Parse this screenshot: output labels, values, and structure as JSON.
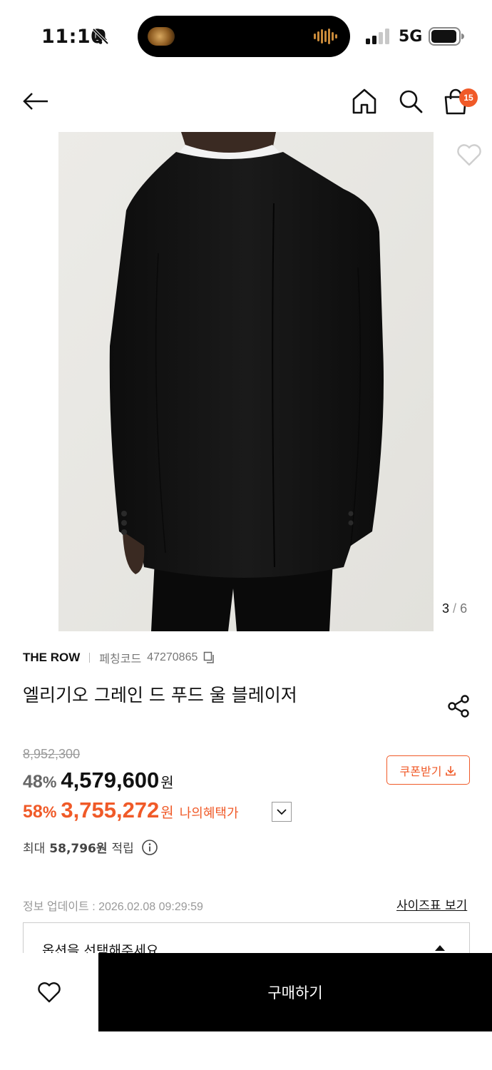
{
  "status_bar": {
    "time": "11:10",
    "network": "5G",
    "icons": [
      "bell-muted-icon",
      "audio-waveform-icon",
      "signal-icon",
      "battery-icon"
    ]
  },
  "header": {
    "cart_count": "15",
    "icons": [
      "back-arrow-icon",
      "home-icon",
      "search-icon",
      "cart-icon"
    ]
  },
  "gallery": {
    "current": "3",
    "separator": "/",
    "total": "6"
  },
  "product": {
    "brand": "THE ROW",
    "code_label": "페칭코드",
    "code": "47270865",
    "title": "엘리기오 그레인 드 푸드 울 블레이저",
    "original_price": "8,952,300",
    "discount_rate": "48",
    "percent_sign": "%",
    "sale_price": "4,579,600",
    "currency": "원",
    "benefit_rate": "58",
    "benefit_price": "3,755,272",
    "benefit_label": "나의혜택가",
    "coupon_label": "쿠폰받기",
    "points_prefix": "최대",
    "points_value": "58,796원",
    "points_suffix": "적립"
  },
  "meta": {
    "update_info": "정보 업데이트 : 2026.02.08 09:29:59",
    "size_chart": "사이즈표 보기"
  },
  "option": {
    "placeholder": "옵션을 선택해주세요"
  },
  "bottom": {
    "buy_label": "구매하기"
  },
  "colors": {
    "accent": "#f05a28",
    "buy_button": "#000000",
    "image_background": "#e8e7e3"
  }
}
